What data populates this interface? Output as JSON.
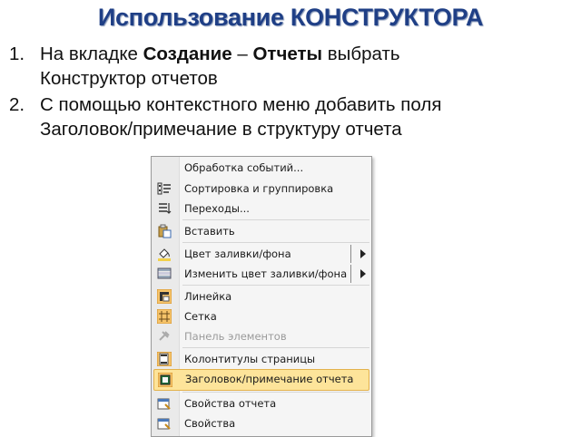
{
  "slide": {
    "title": "Использование КОНСТРУКТОРА"
  },
  "steps": [
    {
      "num": "1.",
      "pre": "На вкладке ",
      "bold1": "Создание",
      "mid": " – ",
      "bold2": "Отчеты",
      "post": " выбрать",
      "line2": "Конструктор отчетов"
    },
    {
      "num": "2.",
      "line1": "С помощью контекстного меню добавить поля",
      "line2": "Заголовок/примечание в структуру отчета"
    }
  ],
  "context_menu": {
    "items": [
      {
        "label": "Обработка событий...",
        "icon": "events-icon"
      },
      {
        "label": "Сортировка и группировка",
        "icon": "sort-group-icon"
      },
      {
        "label": "Переходы...",
        "icon": "tab-order-icon"
      },
      {
        "label": "Вставить",
        "icon": "paste-icon"
      },
      {
        "label": "Цвет заливки/фона",
        "icon": "fill-color-icon",
        "submenu": true
      },
      {
        "label": "Изменить цвет заливки/фона",
        "icon": "alt-fill-color-icon",
        "submenu": true
      },
      {
        "label": "Линейка",
        "icon": "ruler-icon"
      },
      {
        "label": "Сетка",
        "icon": "grid-icon"
      },
      {
        "label": "Панель элементов",
        "icon": "toolbox-icon",
        "disabled": true
      },
      {
        "label": "Колонтитулы страницы",
        "icon": "page-header-footer-icon"
      },
      {
        "label": "Заголовок/примечание отчета",
        "icon": "report-header-footer-icon",
        "highlighted": true
      },
      {
        "label": "Свойства отчета",
        "icon": "report-properties-icon"
      },
      {
        "label": "Свойства",
        "icon": "properties-icon"
      }
    ]
  },
  "colors": {
    "title": "#1f3f86",
    "highlight": "#fde49a",
    "highlight_border": "#e3b24d",
    "menu_bg": "#f5f5f5",
    "icon_active_bg": "#f6c46a"
  }
}
